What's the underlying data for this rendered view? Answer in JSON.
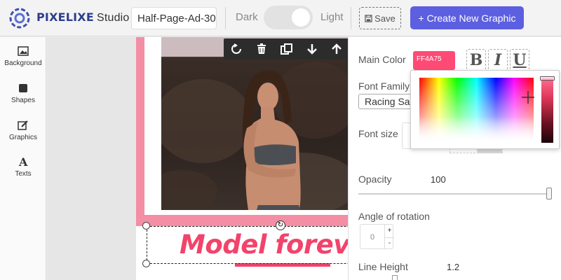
{
  "app": {
    "brand_name": "PIXELIXE",
    "brand_suffix": "Studio",
    "document_name": "Half-Page-Ad-30",
    "theme_dark_label": "Dark",
    "theme_light_label": "Light",
    "theme_selected": "Light",
    "save_label": "Save",
    "create_label": "+ Create New Graphic",
    "accent_color": "#5c5fe0",
    "brand_color": "#2c3e8c"
  },
  "left_toolbar": {
    "items": [
      {
        "label": "Background",
        "icon": "image-icon"
      },
      {
        "label": "Shapes",
        "icon": "square-icon"
      },
      {
        "label": "Graphics",
        "icon": "edit-icon"
      },
      {
        "label": "Texts",
        "icon": "text-icon"
      }
    ]
  },
  "canvas": {
    "headline": "Model forev",
    "subline": "...,,,,·,,,,,.......",
    "headline_color": "#f2436b",
    "frame_color": "#f48ea4",
    "toolbar_icons": [
      "rotate-icon",
      "trash-icon",
      "duplicate-icon",
      "arrow-down-icon",
      "arrow-up-icon"
    ]
  },
  "right_panel": {
    "main_color_label": "Main Color",
    "main_color_value": "FF4A75",
    "bold_label": "B",
    "italic_label": "I",
    "underline_label": "U",
    "font_family_label": "Font Family",
    "font_family_value": "Racing Sa",
    "font_size_label": "Font size",
    "opacity_label": "Opacity",
    "opacity_value": "100",
    "opacity_fraction": 1.0,
    "angle_label": "Angle of rotation",
    "angle_value": "0",
    "angle_plus": "+",
    "angle_minus": "-",
    "line_height_label": "Line Height",
    "line_height_value": "1.2"
  },
  "color_picker": {
    "selected_hex": "#ff4a75"
  }
}
